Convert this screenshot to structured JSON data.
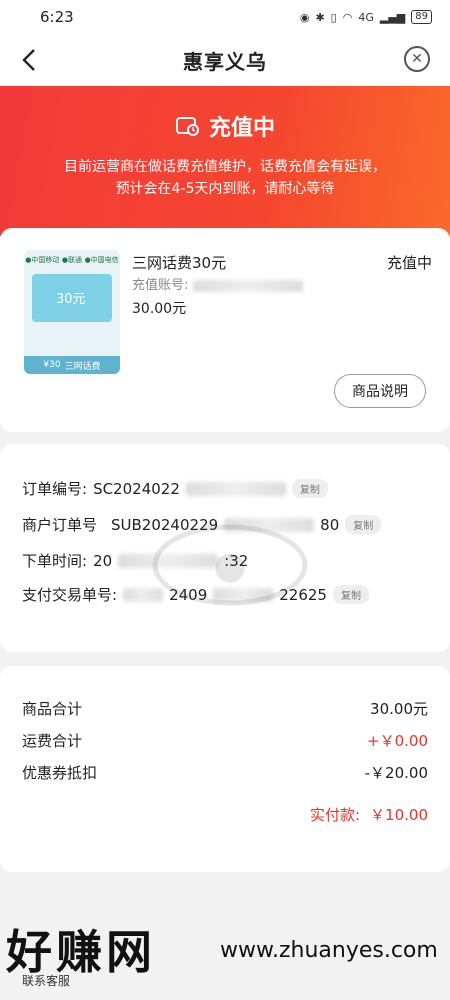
{
  "status_bar": {
    "time": "6:23",
    "net": "4G",
    "battery": "89"
  },
  "nav": {
    "title": "惠享义乌"
  },
  "banner": {
    "status": "充值中",
    "desc_line1": "目前运营商在做话费充值维护，话费充值会有延误，",
    "desc_line2": "预计会在4-5天内到账，请耐心等待"
  },
  "product": {
    "name": "三网话费30元",
    "status": "充值中",
    "account_label": "充值账号:",
    "price": "30.00元",
    "image_amount": "30元",
    "image_bar_price": "¥30",
    "image_bar_text": "三网话费",
    "desc_button": "商品说明"
  },
  "order": {
    "order_no_label": "订单编号:",
    "order_no_value": "SC2024022",
    "merchant_no_label": "商户订单号",
    "merchant_no_value": "SUB20240229",
    "merchant_no_tail": "80",
    "time_label": "下单时间:",
    "time_value": "20",
    "time_tail": ":32",
    "pay_no_label": "支付交易单号:",
    "pay_no_value": "2409",
    "pay_no_tail": "22625",
    "copy_label": "复制"
  },
  "summary": {
    "goods_total_label": "商品合计",
    "goods_total_value": "30.00元",
    "shipping_label": "运费合计",
    "shipping_value": "+￥0.00",
    "coupon_label": "优惠券抵扣",
    "coupon_value": "-￥20.00",
    "paid_label": "实付款:",
    "paid_value": "￥10.00"
  },
  "footer": {
    "brand": "好赚网",
    "url": "www.zhuanyes.com",
    "service": "联系客服"
  },
  "colors": {
    "accent": "#e8342a",
    "banner": "#f23a3a"
  }
}
